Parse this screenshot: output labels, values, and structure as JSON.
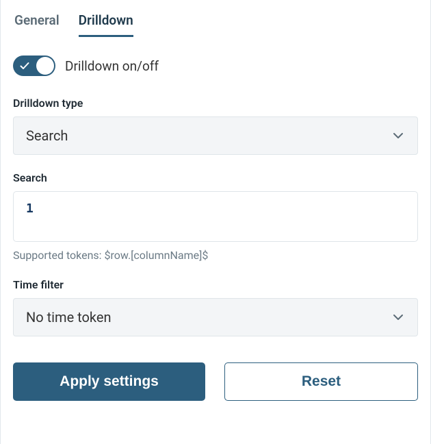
{
  "tabs": {
    "general": "General",
    "drilldown": "Drilldown",
    "active": "drilldown"
  },
  "toggle": {
    "on": true,
    "label": "Drilldown on/off"
  },
  "drilldown_type": {
    "label": "Drilldown type",
    "selected": "Search"
  },
  "search": {
    "label": "Search",
    "value": "1",
    "hint": "Supported tokens: $row.[columnName]$"
  },
  "time_filter": {
    "label": "Time filter",
    "selected": "No time token"
  },
  "buttons": {
    "apply": "Apply settings",
    "reset": "Reset"
  }
}
